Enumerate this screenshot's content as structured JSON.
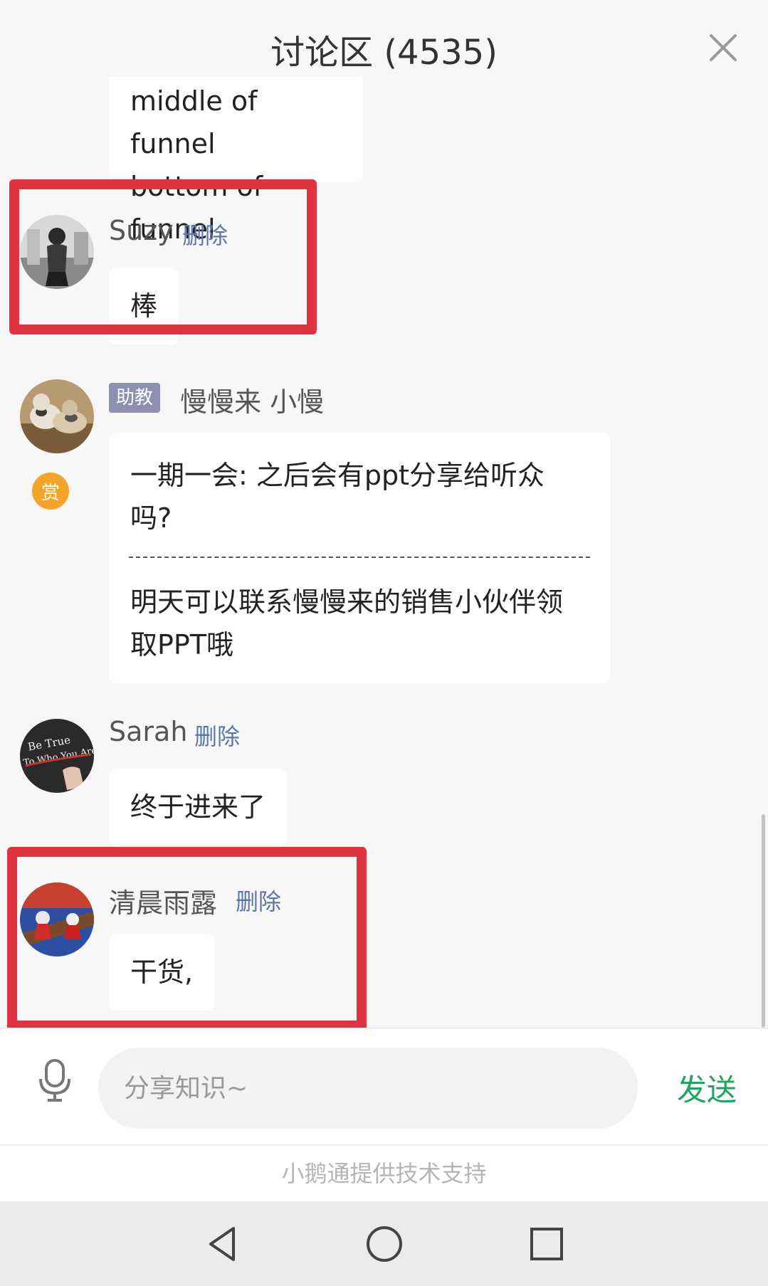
{
  "header": {
    "title": "讨论区 (4535)"
  },
  "messages": [
    {
      "lines": [
        "middle of funnel",
        "bottom of funnel"
      ]
    },
    {
      "user": "Suzy",
      "delete_label": "删除",
      "text": "棒"
    },
    {
      "badge": "助教",
      "user": "慢慢来 小慢",
      "reward_badge": "赏",
      "question_lines": [
        "一期一会: 之后会有ppt分享给听众",
        "吗?"
      ],
      "answer_lines": [
        "明天可以联系慢慢来的销售小伙伴领",
        "取PPT哦"
      ]
    },
    {
      "user": "Sarah",
      "delete_label": "删除",
      "text": "终于进来了"
    },
    {
      "user": "清晨雨露",
      "delete_label": "删除",
      "text": "干货,"
    }
  ],
  "input": {
    "placeholder": "分享知识~",
    "send_label": "发送"
  },
  "footer": {
    "text": "小鹅通提供技术支持"
  },
  "colors": {
    "highlight": "#e0333f",
    "send": "#22a361",
    "delete_link": "#5a77a8",
    "ta_badge": "#8e8fb3",
    "reward_badge": "#f5a42a"
  },
  "icons": {
    "close": "close-icon",
    "mic": "microphone-icon",
    "back": "back-triangle-icon",
    "home": "home-circle-icon",
    "recents": "recents-square-icon"
  }
}
